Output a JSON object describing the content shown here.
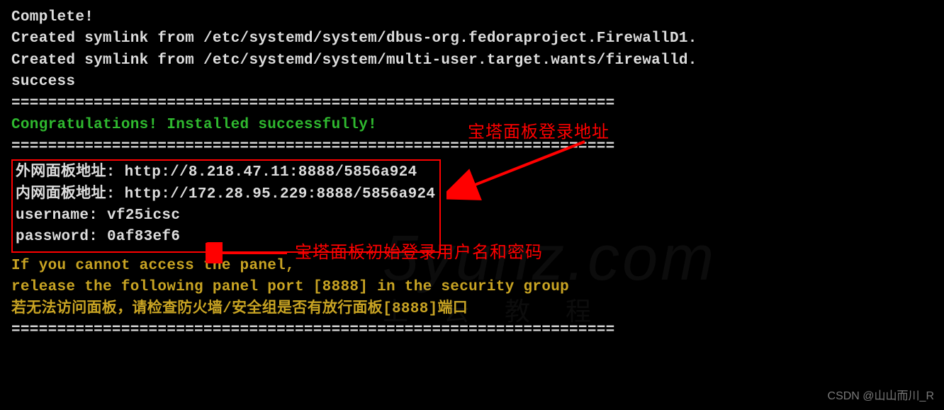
{
  "terminal": {
    "l1": "Complete!",
    "l2": "Created symlink from /etc/systemd/system/dbus-org.fedoraproject.FirewallD1.",
    "l3": "Created symlink from /etc/systemd/system/multi-user.target.wants/firewalld.",
    "l4": "success",
    "sep1": "==================================================================",
    "congrats": "Congratulations! Installed successfully!",
    "sep2": "==================================================================",
    "addr_ext": "外网面板地址: http://8.218.47.11:8888/5856a924",
    "addr_int": "内网面板地址: http://172.28.95.229:8888/5856a924",
    "username": "username: vf25icsc",
    "password": "password: 0af83ef6",
    "warn1": "If you cannot access the panel,",
    "warn2": "release the following panel port [8888] in the security group",
    "warn3": "若无法访问面板，请检查防火墙/安全组是否有放行面板[8888]端口",
    "sep3": "=================================================================="
  },
  "annotations": {
    "addr_label": "宝塔面板登录地址",
    "cred_label": "宝塔面板初始登录用户名和密码"
  },
  "watermark": {
    "main": "5yunz.com",
    "sub": "上云教程",
    "csdn": "CSDN @山山而川_R"
  }
}
